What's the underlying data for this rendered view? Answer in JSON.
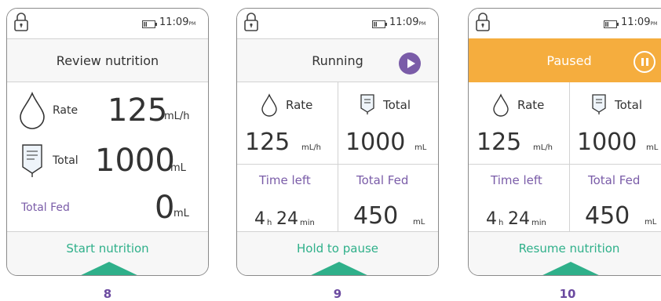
{
  "status_time": "11:09",
  "status_ampm": "PM",
  "colors": {
    "accent_purple": "#7a5ca8",
    "accent_green": "#2fb08a",
    "paused_orange": "#f5ad3e"
  },
  "screens": [
    {
      "step": "8",
      "title": "Review nutrition",
      "rate_label": "Rate",
      "rate_value": "125",
      "rate_unit": "mL/h",
      "total_label": "Total",
      "total_value": "1000",
      "total_unit": "mL",
      "fed_label": "Total Fed",
      "fed_value": "0",
      "fed_unit": "mL",
      "action": "Start nutrition"
    },
    {
      "step": "9",
      "title": "Running",
      "status_icon": "play-icon",
      "rate_label": "Rate",
      "rate_value": "125",
      "rate_unit": "mL/h",
      "total_label": "Total",
      "total_value": "1000",
      "total_unit": "mL",
      "time_left_label": "Time left",
      "hours": "4",
      "h_unit": "h",
      "minutes": "24",
      "min_unit": "min",
      "fed_label": "Total Fed",
      "fed_value": "450",
      "fed_unit": "mL",
      "action": "Hold to pause"
    },
    {
      "step": "10",
      "title": "Paused",
      "status_icon": "pause-icon",
      "rate_label": "Rate",
      "rate_value": "125",
      "rate_unit": "mL/h",
      "total_label": "Total",
      "total_value": "1000",
      "total_unit": "mL",
      "time_left_label": "Time left",
      "hours": "4",
      "h_unit": "h",
      "minutes": "24",
      "min_unit": "min",
      "fed_label": "Total Fed",
      "fed_value": "450",
      "fed_unit": "mL",
      "action": "Resume nutrition"
    }
  ]
}
